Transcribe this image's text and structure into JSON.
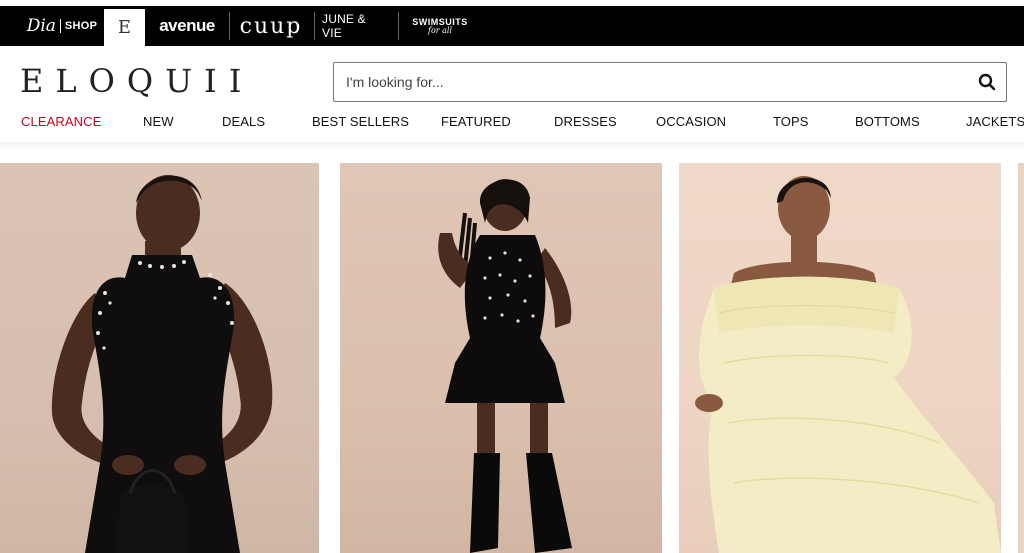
{
  "brand_bar": {
    "brands": {
      "dia_script": "Dia",
      "dia_shop": "SHOP",
      "eloquii_mark": "E",
      "avenue": "avenue",
      "cuup": "cuup",
      "june_vie": "JUNE & VIE",
      "swimsuits_line1": "SWIMSUITS",
      "swimsuits_line2": "for all"
    }
  },
  "header": {
    "logo": "ELOQUII",
    "search": {
      "placeholder": "I'm looking for...",
      "icon": "search-icon"
    }
  },
  "nav": {
    "items": [
      "CLEARANCE",
      "NEW",
      "DEALS",
      "BEST SELLERS",
      "FEATURED",
      "DRESSES",
      "OCCASION",
      "TOPS",
      "BOTTOMS",
      "JACKETS"
    ],
    "highlight_color": "#d0021b"
  },
  "products": {
    "items": [
      {
        "image": "model-black-embellished-mock-neck-dress"
      },
      {
        "image": "model-black-beaded-tiered-mini-dress"
      },
      {
        "image": "model-yellow-lace-off-shoulder-gown"
      }
    ]
  }
}
